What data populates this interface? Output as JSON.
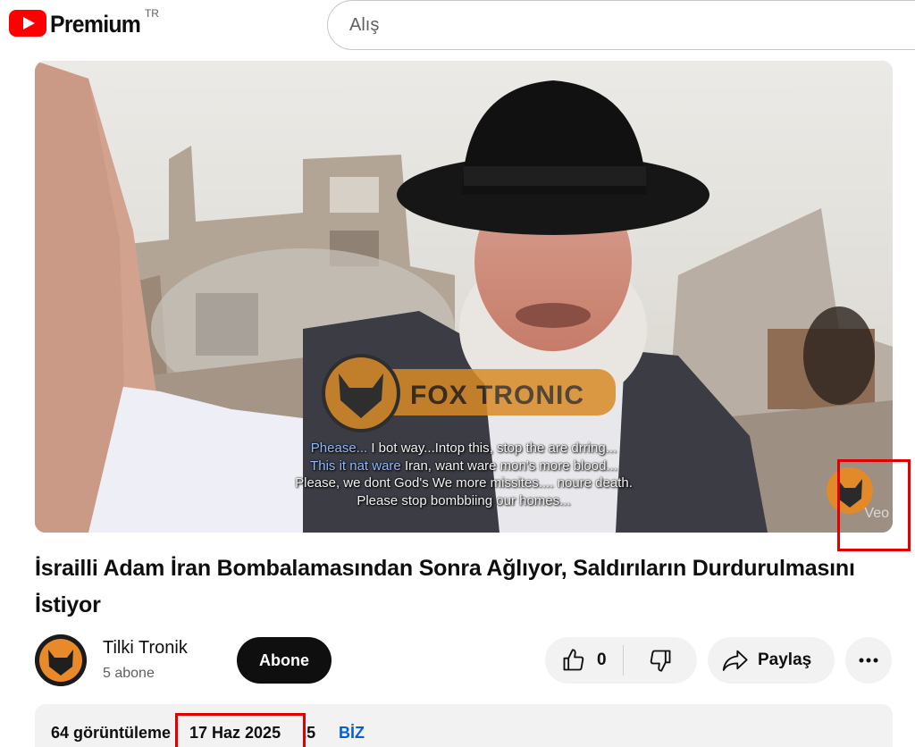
{
  "header": {
    "logo_text": "Premium",
    "country_code": "TR",
    "search_value": "Alış"
  },
  "video": {
    "watermark_text": "FOX TRONIC",
    "subtitle_lines": [
      {
        "a": "Pheasе...",
        "b": " I bot way...Intop this, stop the are drring..."
      },
      {
        "a": "This it nat ware",
        "b": " Iran, want ware mon's more blood..."
      },
      {
        "a": "",
        "b": "Please, we dont God's We more missites.... noure death."
      },
      {
        "a": "",
        "b": "Please stop bombbiing our homes..."
      }
    ],
    "corner_label": "Veo"
  },
  "title": "İsrailli Adam İran Bombalamasından Sonra Ağlıyor, Saldırıların Durdurulmasını İstiyor",
  "channel": {
    "name": "Tilki Tronik",
    "subscribers": "5 abone",
    "subscribe_label": "Abone"
  },
  "actions": {
    "like_count": "0",
    "share_label": "Paylaş"
  },
  "description": {
    "views": "64 görüntüleme",
    "date": "17 Haz 2025",
    "hashtag": "BİZ"
  },
  "colors": {
    "brand_red": "#ff0000",
    "highlight_red": "#e00000",
    "link_blue": "#065fd4"
  }
}
